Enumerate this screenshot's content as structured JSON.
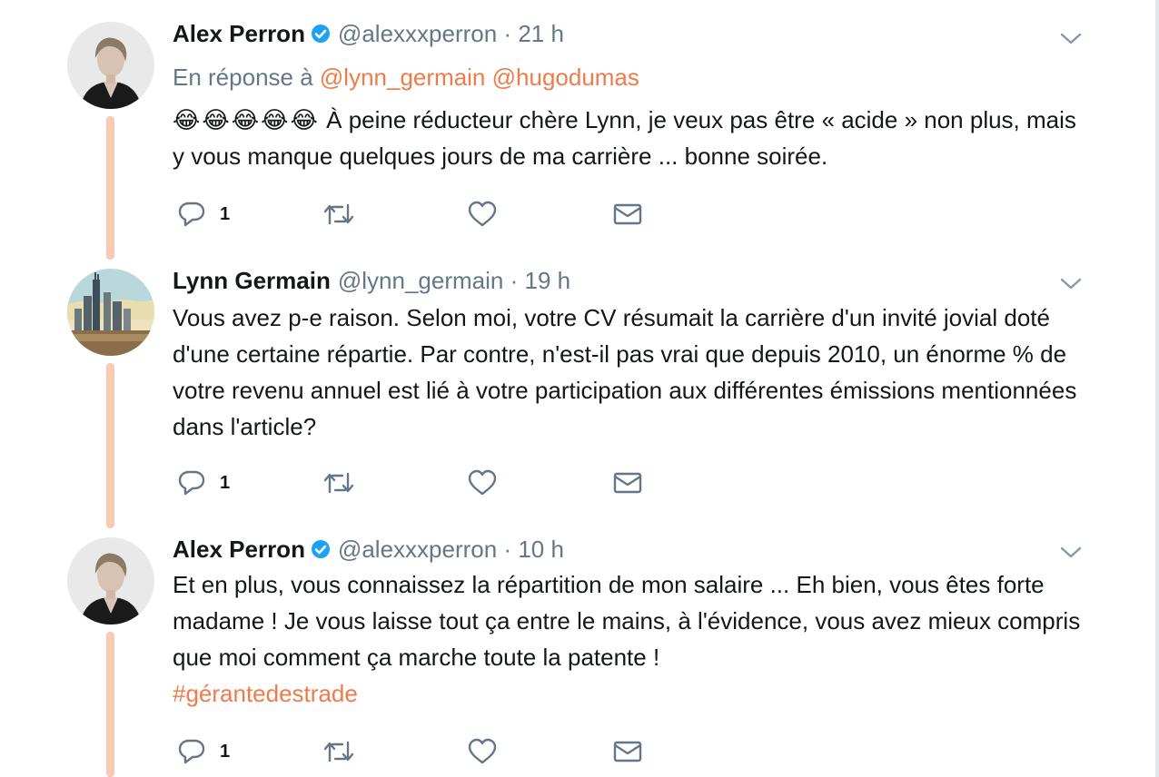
{
  "colors": {
    "accent": "#ef7b4b",
    "thread_line": "#f8c9b3",
    "muted": "#657786",
    "verified": "#1da1f2"
  },
  "tweets": [
    {
      "name": "Alex Perron",
      "verified": true,
      "handle": "@alexxxperron",
      "dot": "·",
      "time": "21 h",
      "reply_prefix": "En réponse à",
      "reply_mentions": [
        "@lynn_germain",
        "@hugodumas"
      ],
      "emojis": "😂😂😂😂😂",
      "text": "À peine réducteur chère Lynn, je veux pas être « acide » non plus, mais y vous manque quelques jours de ma carrière ... bonne soirée.",
      "reply_count": "1",
      "avatar_icon": "person-portrait-avatar"
    },
    {
      "name": "Lynn Germain",
      "verified": false,
      "handle": "@lynn_germain",
      "dot": "·",
      "time": "19 h",
      "text": "Vous avez p-e raison. Selon moi, votre CV résumait la carrière d'un invité jovial doté d'une certaine répartie. Par contre, n'est-il pas vrai que depuis 2010, un énorme % de votre revenu annuel est lié à votre participation aux différentes émissions mentionnées dans l'article?",
      "reply_count": "1",
      "avatar_icon": "city-skyline-avatar"
    },
    {
      "name": "Alex Perron",
      "verified": true,
      "handle": "@alexxxperron",
      "dot": "·",
      "time": "10 h",
      "text": "Et en plus, vous connaissez la répartition de mon salaire ... Eh bien, vous êtes forte madame ! Je vous laisse tout ça entre le mains, à l'évidence, vous avez mieux compris que moi comment ça marche toute la patente !",
      "hashtag": "#gérantedestrade",
      "reply_count": "1",
      "avatar_icon": "person-portrait-avatar"
    }
  ]
}
